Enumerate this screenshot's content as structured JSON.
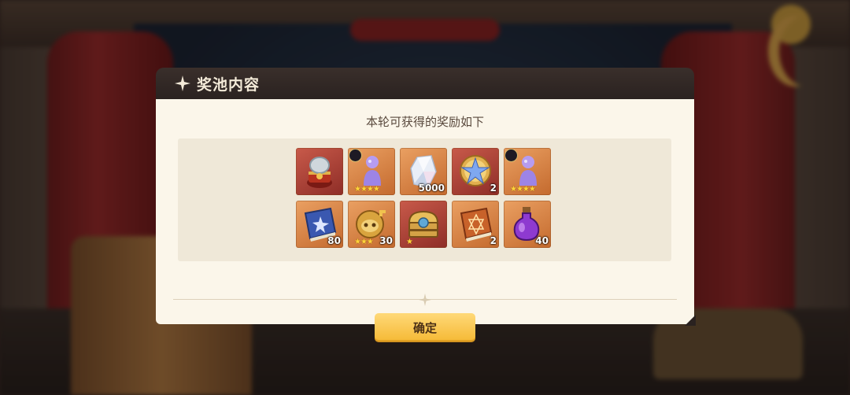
{
  "dialog": {
    "title": "奖池内容",
    "subtitle": "本轮可获得的奖励如下",
    "confirm_label": "确定"
  },
  "items": [
    {
      "name": "mechanism-gift-box",
      "quantity": "",
      "stars": "",
      "quality": "red",
      "icon": "box-icon"
    },
    {
      "name": "purple-figure-a",
      "quantity": "",
      "stars": "★★★★",
      "quality": "orange",
      "icon": "figure-icon"
    },
    {
      "name": "crystal",
      "quantity": "5000",
      "stars": "",
      "quality": "orange",
      "icon": "crystal-icon"
    },
    {
      "name": "star-medal",
      "quantity": "2",
      "stars": "",
      "quality": "red",
      "icon": "star-medal-icon"
    },
    {
      "name": "purple-figure-b",
      "quantity": "",
      "stars": "★★★★",
      "quality": "orange",
      "icon": "figure-icon"
    },
    {
      "name": "blue-book",
      "quantity": "80",
      "stars": "",
      "quality": "orange",
      "icon": "book-icon"
    },
    {
      "name": "gold-mask",
      "quantity": "30",
      "stars": "★★★",
      "quality": "orange",
      "icon": "mask-icon"
    },
    {
      "name": "golden-chest",
      "quantity": "",
      "stars": "★",
      "quality": "red",
      "icon": "chest-icon"
    },
    {
      "name": "orange-book",
      "quantity": "2",
      "stars": "",
      "quality": "orange",
      "icon": "book-icon"
    },
    {
      "name": "purple-potion",
      "quantity": "40",
      "stars": "",
      "quality": "orange",
      "icon": "potion-icon"
    }
  ]
}
